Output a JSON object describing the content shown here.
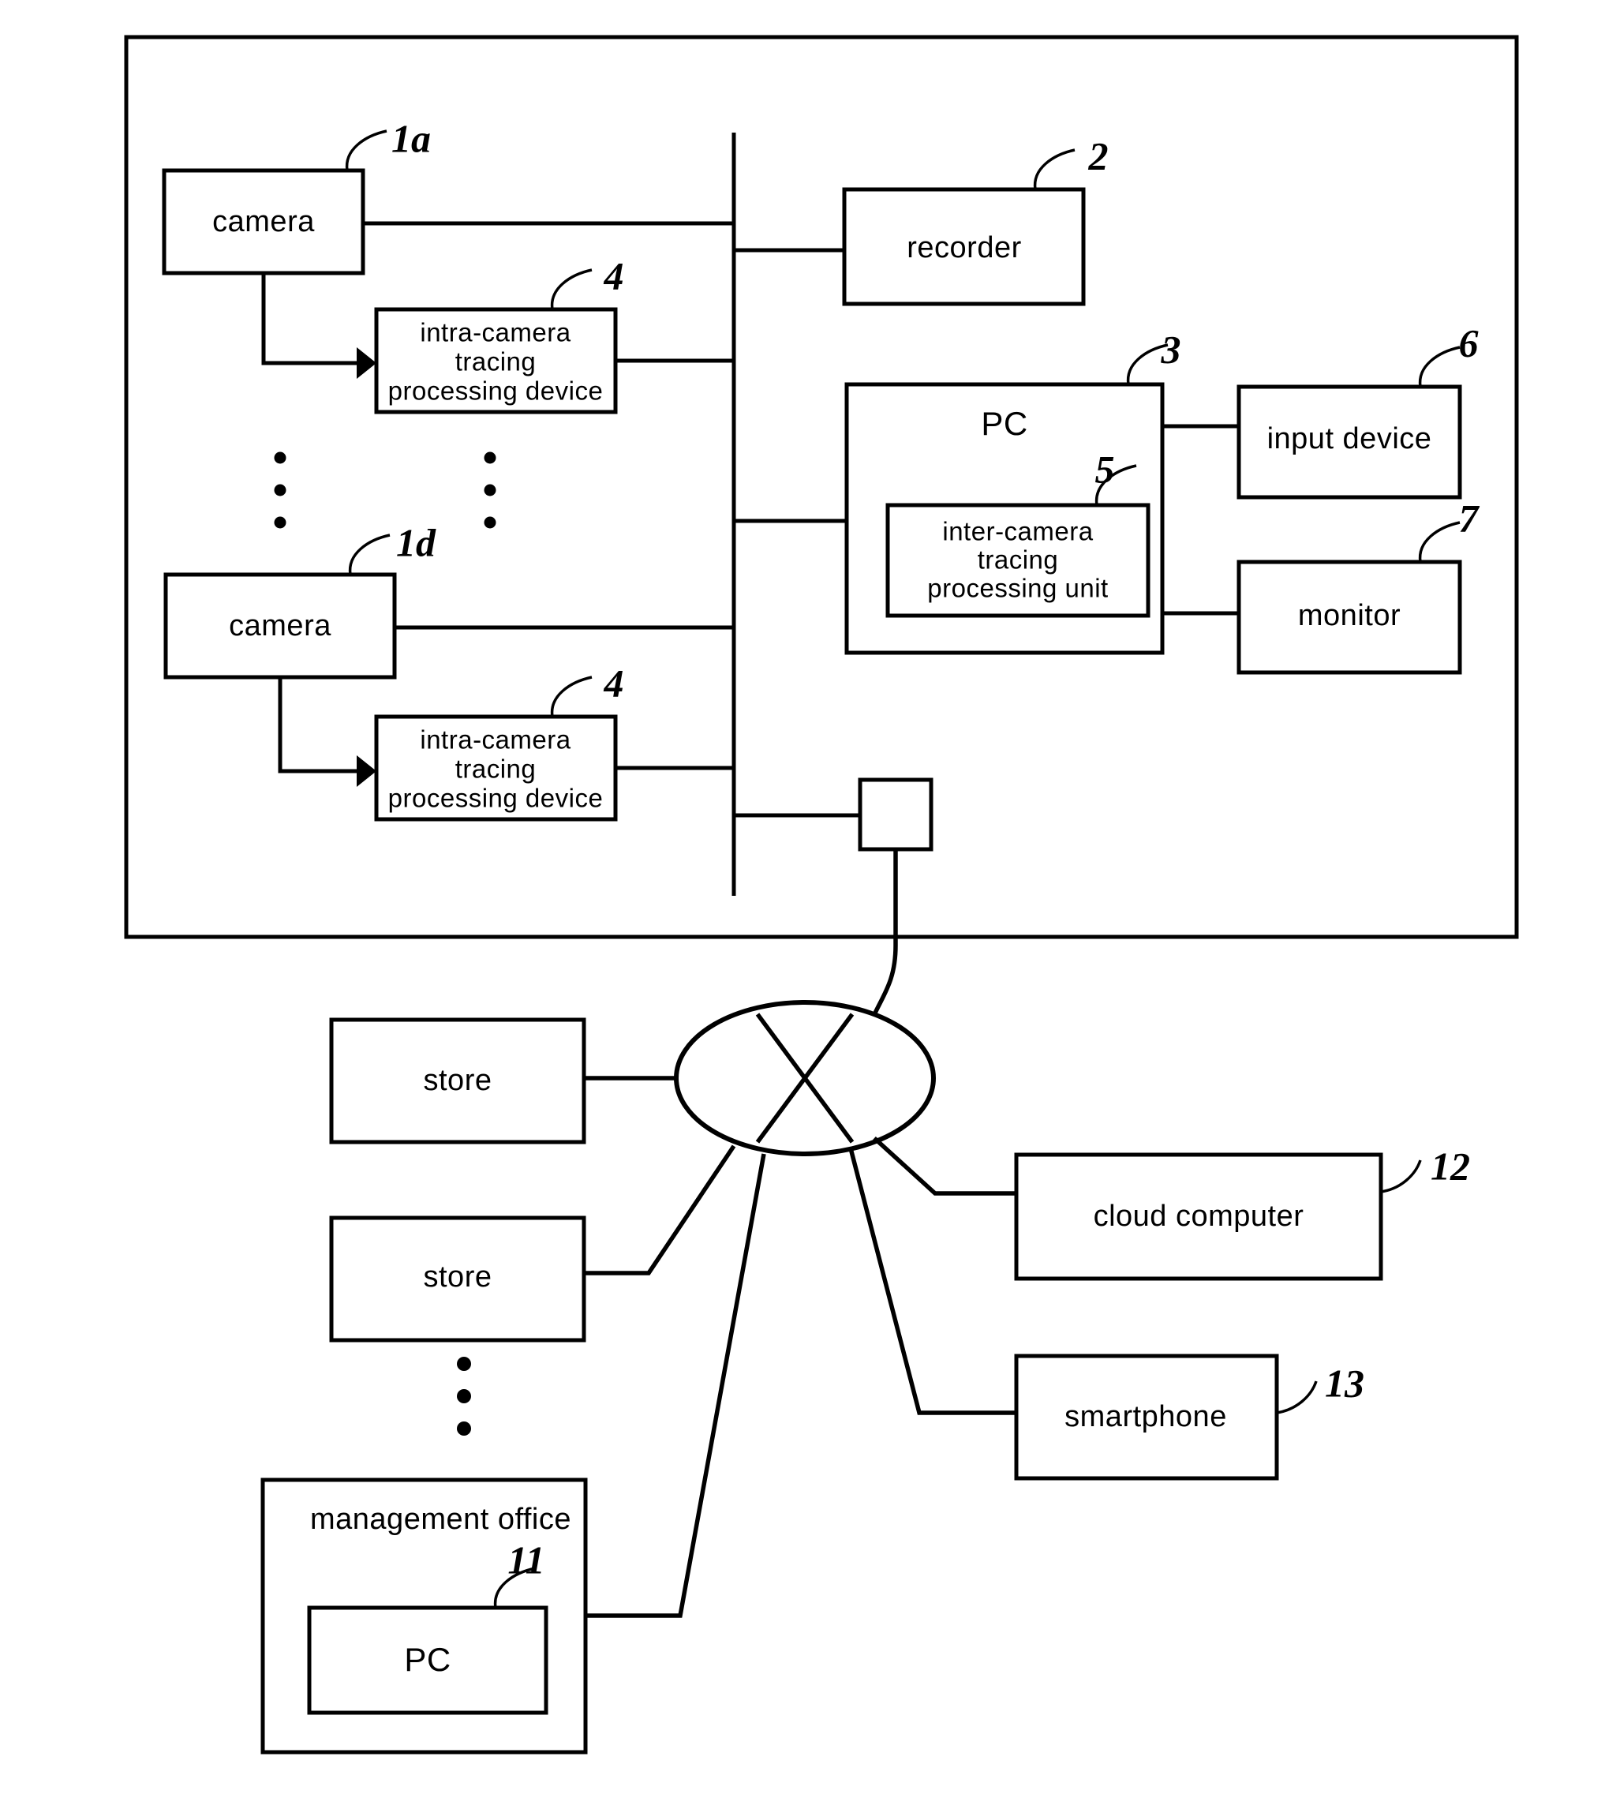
{
  "figure": {
    "type": "patent-system-block-diagram",
    "store_frame_label": "store",
    "boxes": {
      "camera_top": "camera",
      "camera_bottom": "camera",
      "intra_camera_top": [
        "intra-camera",
        "tracing",
        "processing device"
      ],
      "intra_camera_bottom": [
        "intra-camera",
        "tracing",
        "processing device"
      ],
      "recorder": "recorder",
      "pc": "PC",
      "inter_camera_unit": [
        "inter-camera",
        "tracing",
        "processing unit"
      ],
      "input_device": "input device",
      "monitor": "monitor",
      "store_remote_1": "store",
      "store_remote_2": "store",
      "management_office": "management office",
      "management_office_pc": "PC",
      "cloud_computer": "cloud computer",
      "smartphone": "smartphone"
    },
    "reference_numerals": {
      "camera_top": "1a",
      "camera_bottom": "1d",
      "recorder": "2",
      "pc": "3",
      "intra_camera_top": "4",
      "intra_camera_bottom": "4",
      "inter_camera_unit": "5",
      "input_device": "6",
      "monitor": "7",
      "management_office_pc": "11",
      "cloud_computer": "12",
      "smartphone": "13"
    },
    "ellipsis_markers": [
      {
        "name": "camera-column-ellipsis",
        "dots": 3
      },
      {
        "name": "intra-camera-column-ellipsis",
        "dots": 3
      },
      {
        "name": "remote-store-ellipsis",
        "dots": 3
      }
    ],
    "network_node": {
      "name": "network-cloud",
      "shape": "ellipse-with-x"
    }
  }
}
